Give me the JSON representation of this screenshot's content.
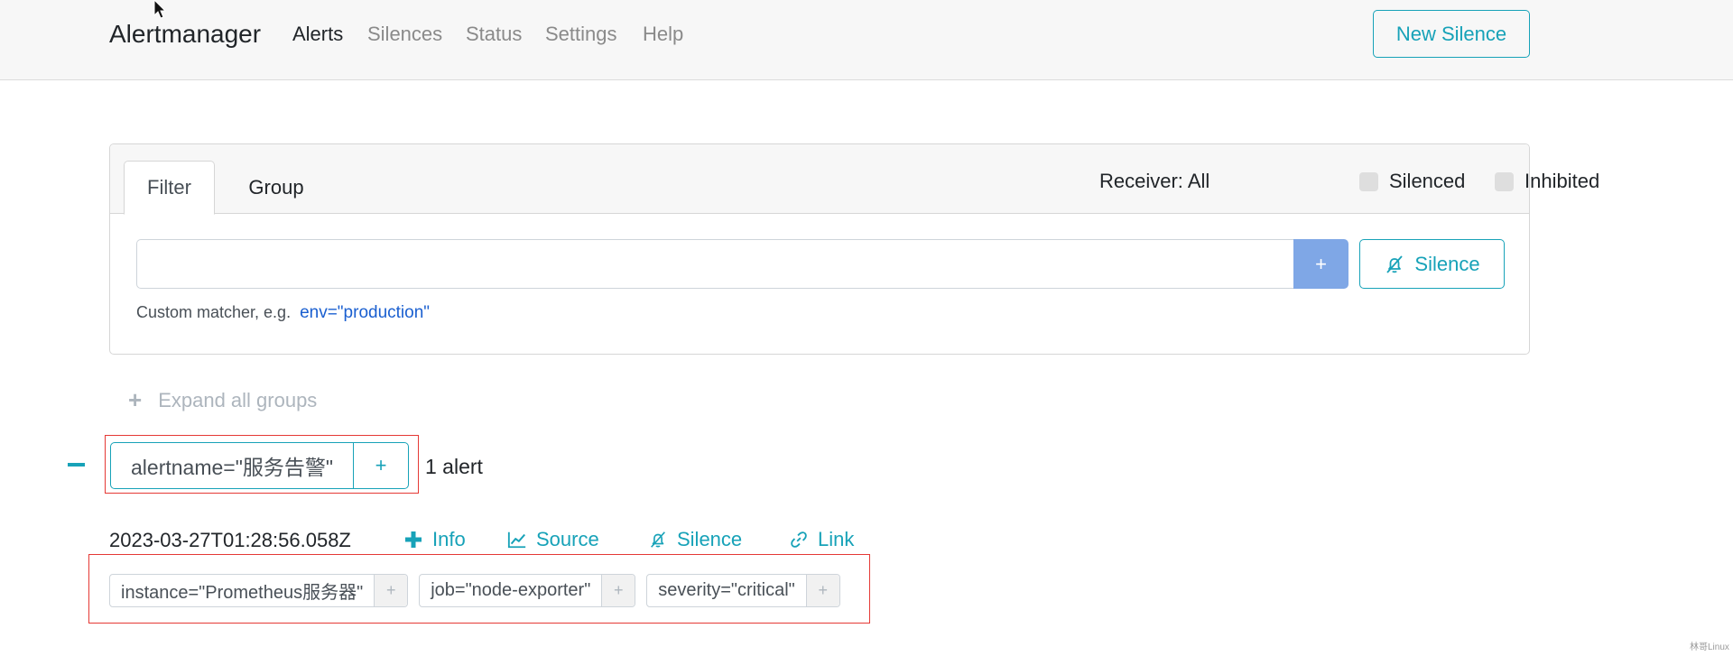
{
  "navbar": {
    "brand": "Alertmanager",
    "links": [
      "Alerts",
      "Silences",
      "Status",
      "Settings",
      "Help"
    ],
    "active": "Alerts",
    "new_silence_label": "New Silence"
  },
  "filter_card": {
    "tabs": [
      "Filter",
      "Group"
    ],
    "active_tab": "Filter",
    "receiver_label": "Receiver: All",
    "silenced_label": "Silenced",
    "inhibited_label": "Inhibited",
    "matcher_value": "",
    "add_label": "+",
    "silence_label": "Silence",
    "hint_text": "Custom matcher, e.g.",
    "hint_example": "env=\"production\""
  },
  "expand_all_label": "Expand all groups",
  "group": {
    "label": "alertname=\"服务告警\"",
    "plus": "+",
    "count": "1 alert"
  },
  "alert": {
    "timestamp": "2023-03-27T01:28:56.058Z",
    "actions": [
      "Info",
      "Source",
      "Silence",
      "Link"
    ],
    "labels": [
      "instance=\"Prometheus服务器\"",
      "job=\"node-exporter\"",
      "severity=\"critical\""
    ],
    "label_plus": "+"
  },
  "colors": {
    "accent": "#17a2b8",
    "primary_button": "#7fa7e6",
    "highlight_box": "#e53935",
    "link_example": "#1a5fd0"
  },
  "watermark": "林哥Linux"
}
